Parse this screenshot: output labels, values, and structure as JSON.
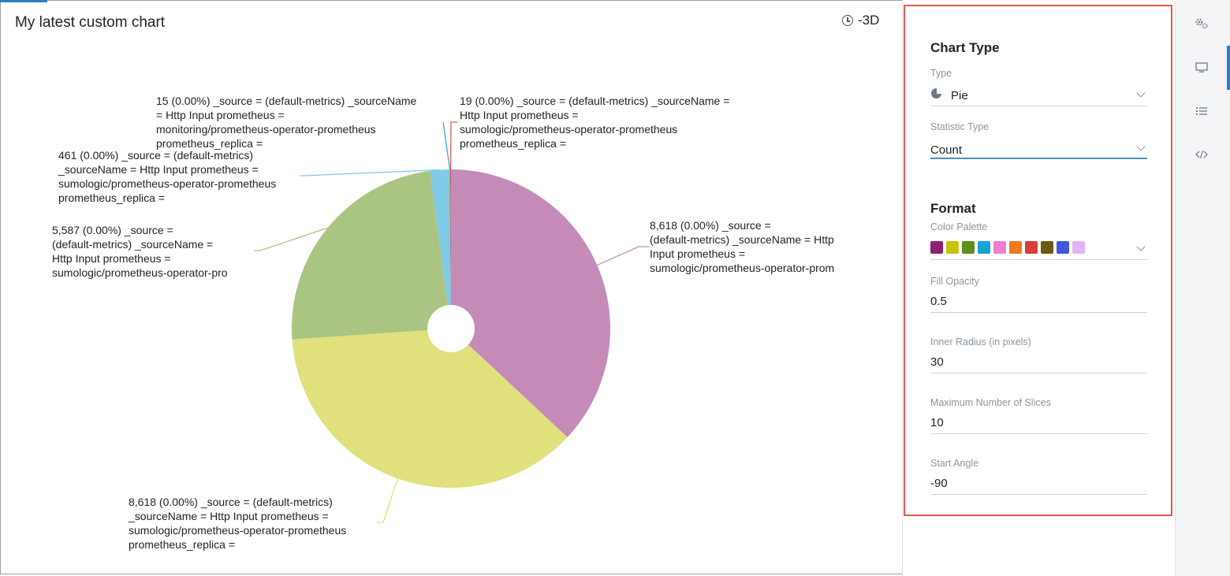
{
  "chart_title": "My latest custom chart",
  "time_range": "-3D",
  "chart_data": {
    "type": "pie",
    "title": "My latest custom chart",
    "slices": [
      {
        "value": 8618,
        "color": "#c58bb8",
        "label": "8,618 (0.00%) _source =\n(default-metrics) _sourceName = Http\nInput prometheus =\nsumologic/prometheus-operator-prom"
      },
      {
        "value": 8618,
        "color": "#e0e07d",
        "label": "8,618 (0.00%) _source = (default-metrics)\n_sourceName = Http Input prometheus =\nsumologic/prometheus-operator-prometheus\nprometheus_replica ="
      },
      {
        "value": 5587,
        "color": "#aac482",
        "label": "5,587 (0.00%) _source =\n(default-metrics) _sourceName =\nHttp Input prometheus =\nsumologic/prometheus-operator-pro"
      },
      {
        "value": 461,
        "color": "#7fcbe6",
        "label": "461 (0.00%) _source = (default-metrics)\n_sourceName = Http Input prometheus =\nsumologic/prometheus-operator-prometheus\nprometheus_replica ="
      },
      {
        "value": 15,
        "color": "#3aa3da",
        "label": "15 (0.00%) _source = (default-metrics) _sourceName\n= Http Input prometheus =\nmonitoring/prometheus-operator-prometheus\nprometheus_replica ="
      },
      {
        "value": 19,
        "color": "#e8584d",
        "label": "19 (0.00%) _source = (default-metrics) _sourceName =\nHttp Input prometheus =\nsumologic/prometheus-operator-prometheus\nprometheus_replica ="
      }
    ],
    "start_angle": -90,
    "inner_radius": 30
  },
  "settings": {
    "chart_type_title": "Chart Type",
    "type_label": "Type",
    "type_value": "Pie",
    "statistic_label": "Statistic Type",
    "statistic_value": "Count",
    "format_title": "Format",
    "palette_label": "Color Palette",
    "palette": [
      "#8f1f74",
      "#c7c20b",
      "#5f8f1c",
      "#1aa1d6",
      "#ef7fd0",
      "#ee7a1f",
      "#d83c3c",
      "#6a5a12",
      "#3e5ad8",
      "#e0b4f4"
    ],
    "fill_opacity_label": "Fill Opacity",
    "fill_opacity_value": "0.5",
    "inner_radius_label": "Inner Radius (in pixels)",
    "inner_radius_value": "30",
    "max_slices_label": "Maximum Number of Slices",
    "max_slices_value": "10",
    "start_angle_label": "Start Angle",
    "start_angle_value": "-90"
  },
  "rail": {
    "icons": [
      "settings-gears-icon",
      "display-icon",
      "list-icon",
      "code-icon"
    ]
  }
}
